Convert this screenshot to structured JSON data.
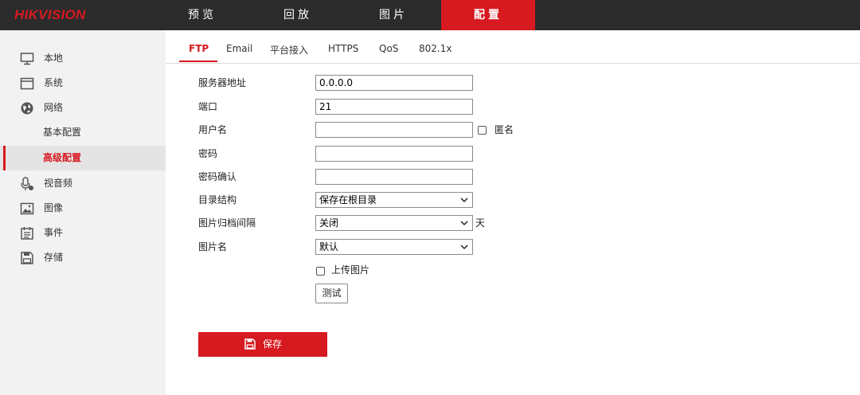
{
  "brand": {
    "logo_text": "HIKVISION"
  },
  "nav": {
    "tabs": [
      {
        "label": "预览"
      },
      {
        "label": "回放"
      },
      {
        "label": "图片"
      },
      {
        "label": "配置"
      }
    ],
    "active": "配置"
  },
  "sidebar": {
    "items": [
      {
        "label": "本地",
        "icon": "monitor-icon"
      },
      {
        "label": "系统",
        "icon": "window-icon"
      },
      {
        "label": "网络",
        "icon": "globe-icon"
      },
      {
        "label": "视音频",
        "icon": "microphone-icon"
      },
      {
        "label": "图像",
        "icon": "image-icon"
      },
      {
        "label": "事件",
        "icon": "calendar-icon"
      },
      {
        "label": "存储",
        "icon": "floppy-icon"
      }
    ],
    "network_sub": [
      {
        "label": "基本配置"
      },
      {
        "label": "高级配置"
      }
    ],
    "active_sub": "高级配置"
  },
  "subtabs": {
    "items": [
      {
        "label": "FTP"
      },
      {
        "label": "Email"
      },
      {
        "label": "平台接入"
      },
      {
        "label": "HTTPS"
      },
      {
        "label": "QoS"
      },
      {
        "label": "802.1x"
      }
    ],
    "active": "FTP"
  },
  "form": {
    "server_address": {
      "label": "服务器地址",
      "value": "0.0.0.0"
    },
    "port": {
      "label": "端口",
      "value": "21"
    },
    "username": {
      "label": "用户名",
      "value": "",
      "anonymous_label": "匿名",
      "anonymous_checked": false
    },
    "password": {
      "label": "密码",
      "value": ""
    },
    "password_confirm": {
      "label": "密码确认",
      "value": ""
    },
    "directory": {
      "label": "目录结构",
      "value": "保存在根目录"
    },
    "archive_interval": {
      "label": "图片归档间隔",
      "value": "关闭",
      "suffix": "天"
    },
    "picture_name": {
      "label": "图片名",
      "value": "默认"
    },
    "upload_picture": {
      "label": "上传图片",
      "checked": false
    },
    "test_label": "测试",
    "save_label": "保存"
  },
  "colors": {
    "accent": "#d71920",
    "topbar": "#2b2b2b",
    "sidebar": "#f2f2f2"
  }
}
